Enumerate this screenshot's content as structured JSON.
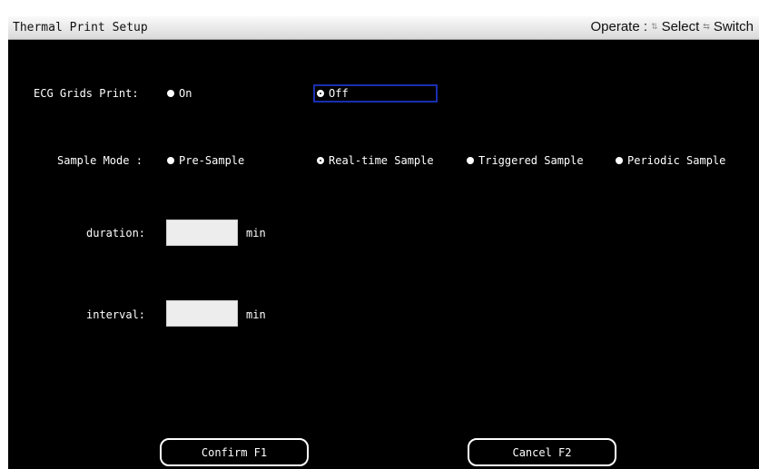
{
  "window": {
    "title": "Thermal Print Setup",
    "hint": {
      "operate_label": "Operate :",
      "select_icon": "up-down-arrows-icon",
      "select_label": "Select",
      "switch_icon": "left-right-arrows-icon",
      "switch_label": "Switch"
    }
  },
  "ecg_grids": {
    "label": "ECG Grids Print:",
    "options": [
      {
        "label": "On",
        "selected": false
      },
      {
        "label": "Off",
        "selected": true,
        "focused": true
      }
    ]
  },
  "sample_mode": {
    "label": "Sample Mode :",
    "options": [
      {
        "label": "Pre-Sample",
        "selected": false
      },
      {
        "label": "Real-time Sample",
        "selected": true
      },
      {
        "label": "Triggered Sample",
        "selected": false
      },
      {
        "label": "Periodic Sample",
        "selected": false
      }
    ]
  },
  "duration": {
    "label": "duration:",
    "value": "",
    "unit": "min"
  },
  "interval": {
    "label": "interval:",
    "value": "",
    "unit": "min"
  },
  "buttons": {
    "confirm_label": "Confirm F1",
    "cancel_label": "Cancel F2"
  },
  "colors": {
    "panel_background": "#000000",
    "focus_outline": "#1a2fb0",
    "text": "#ffffff"
  }
}
